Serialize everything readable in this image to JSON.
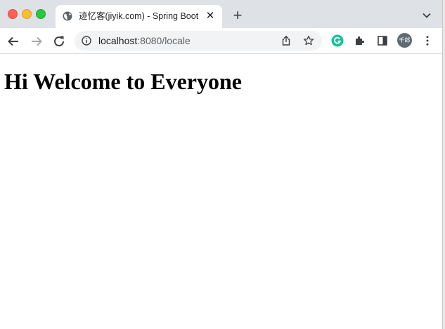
{
  "window": {
    "traffic_lights": [
      "close",
      "minimize",
      "zoom"
    ]
  },
  "tab": {
    "title": "迹忆客(jiyik.com) - Spring Boot",
    "favicon": "globe-icon",
    "close_label": "✕"
  },
  "new_tab_label": "+",
  "address_bar": {
    "host": "localhost",
    "path": ":8080/locale"
  },
  "profile": {
    "avatar_text": "千郎"
  },
  "page": {
    "heading": "Hi Welcome to Everyone"
  },
  "colors": {
    "titlebar": "#dee1e6",
    "omnibox": "#f1f3f4",
    "grammarly": "#15c39a"
  }
}
